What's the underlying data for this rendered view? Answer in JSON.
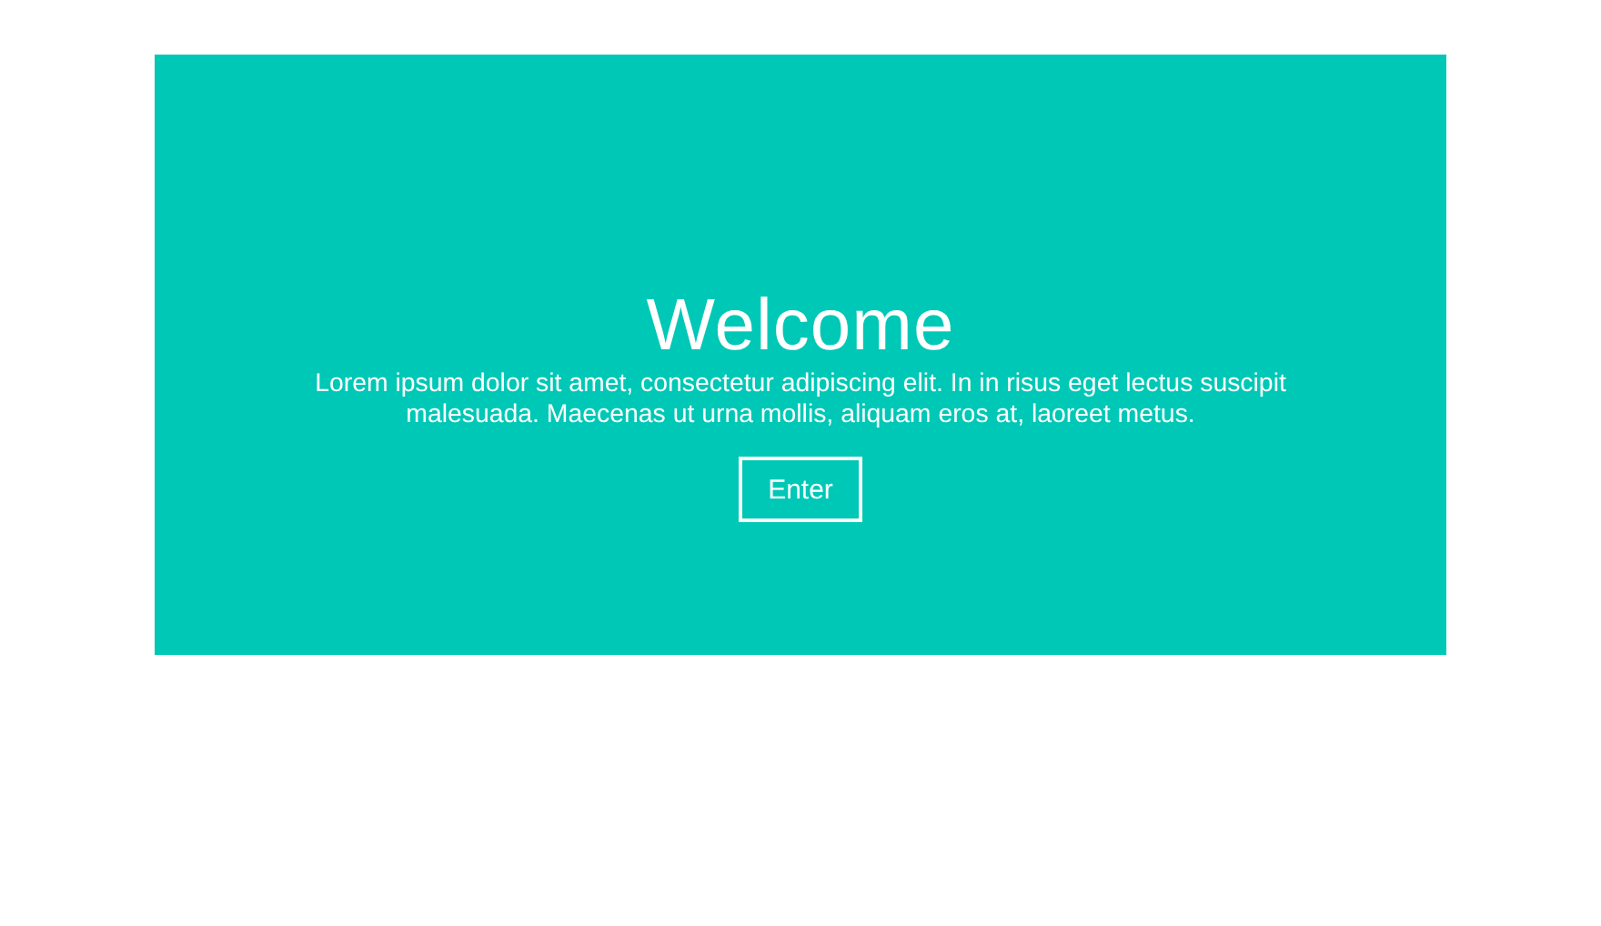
{
  "hero": {
    "title": "Welcome",
    "text": "Lorem ipsum dolor sit amet, consectetur adipiscing elit. In in risus eget lectus suscipit malesuada. Maecenas ut urna mollis, aliquam eros at, laoreet metus.",
    "button": "Enter"
  }
}
